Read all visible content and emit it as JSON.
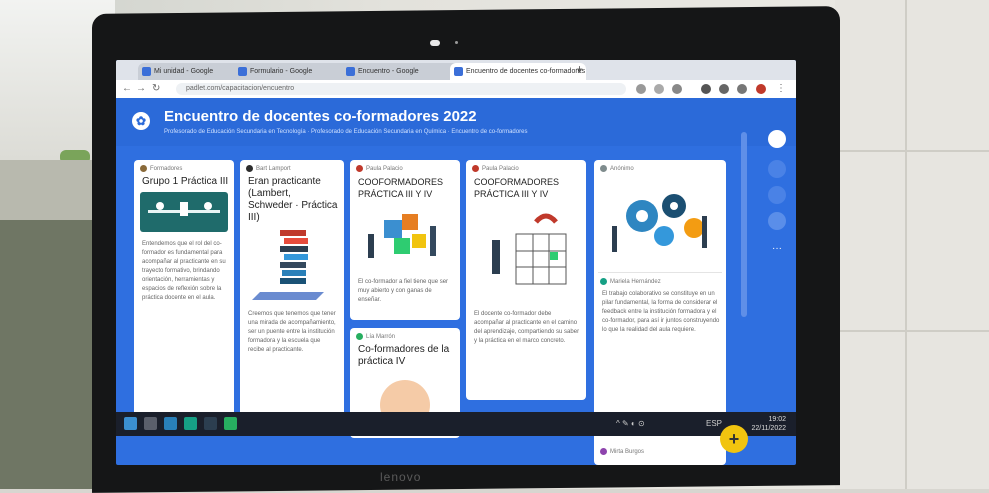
{
  "browser": {
    "tabs": [
      {
        "label": "Mi unidad - Google",
        "active": false
      },
      {
        "label": "Formulario - Google",
        "active": false
      },
      {
        "label": "Encuentro - Google",
        "active": false
      },
      {
        "label": "Encuentro de docentes co-formadores",
        "active": true
      }
    ],
    "url": "padlet.com/capacitacion/encuentro"
  },
  "padlet": {
    "title": "Encuentro de docentes co-formadores 2022",
    "subtitle": "Profesorado de Educación Secundaria en Tecnología · Profesorado de Educación Secundaria en Química · Encuentro de co-formadores"
  },
  "cards": [
    {
      "author": "Formadores",
      "title": "Grupo 1 Práctica III",
      "text": "Entendemos que el rol del co-formador es fundamental para acompañar al practicante en su trayecto formativo, brindando orientación, herramientas y espacios de reflexión sobre la práctica docente en el aula."
    },
    {
      "author": "Bart Lamport",
      "title": "Eran practicante (Lambert, Schweder · Práctica III)",
      "text": "Creemos que tenemos que tener una mirada de acompañamiento, ser un puente entre la institución formadora y la escuela que recibe al practicante."
    },
    {
      "author": "Paula Palacio",
      "title": "COOFORMADORES PRÁCTICA III Y IV",
      "text": "El co-formador a fiel tiene que ser muy abierto y con ganas de enseñar."
    },
    {
      "author": "Paula Palacio",
      "title": "COOFORMADORES PRÁCTICA III Y IV",
      "text": "El docente co-formador debe acompañar al practicante en el camino del aprendizaje, compartiendo su saber y la práctica en el marco concreto."
    },
    {
      "author": "Anónimo",
      "title": "",
      "text": ""
    },
    {
      "author": "Lía Marrón",
      "title": "Co-formadores de la práctica IV",
      "text": ""
    }
  ],
  "comment": {
    "author": "Mariela Hernández",
    "text": "El trabajo colaborativo se constituye en un pilar fundamental, la forma de considerar el feedback entre la institución formadora y el co-formador, para así ir juntos construyendo lo que la realidad del aula requiere."
  },
  "comment2": {
    "author": "Mirta Burgos"
  },
  "taskbar": {
    "time": "19:02",
    "date": "22/11/2022",
    "lang": "ESP"
  },
  "laptop": {
    "brand": "lenovo"
  },
  "fab_label": "+",
  "colors": {
    "padlet_bg": "#2f6fe0",
    "fab": "#f1c40f"
  }
}
